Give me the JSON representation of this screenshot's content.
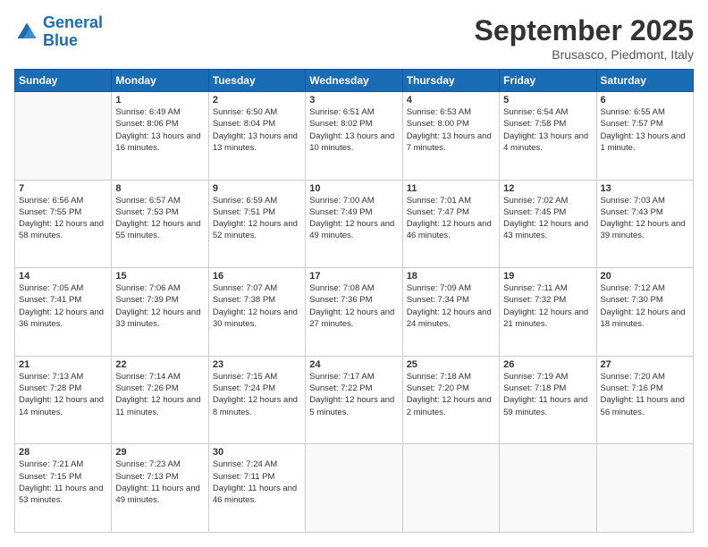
{
  "logo": {
    "line1": "General",
    "line2": "Blue"
  },
  "header": {
    "month": "September 2025",
    "location": "Brusasco, Piedmont, Italy"
  },
  "weekdays": [
    "Sunday",
    "Monday",
    "Tuesday",
    "Wednesday",
    "Thursday",
    "Friday",
    "Saturday"
  ],
  "weeks": [
    [
      {
        "day": "",
        "sunrise": "",
        "sunset": "",
        "daylight": ""
      },
      {
        "day": "1",
        "sunrise": "Sunrise: 6:49 AM",
        "sunset": "Sunset: 8:06 PM",
        "daylight": "Daylight: 13 hours and 16 minutes."
      },
      {
        "day": "2",
        "sunrise": "Sunrise: 6:50 AM",
        "sunset": "Sunset: 8:04 PM",
        "daylight": "Daylight: 13 hours and 13 minutes."
      },
      {
        "day": "3",
        "sunrise": "Sunrise: 6:51 AM",
        "sunset": "Sunset: 8:02 PM",
        "daylight": "Daylight: 13 hours and 10 minutes."
      },
      {
        "day": "4",
        "sunrise": "Sunrise: 6:53 AM",
        "sunset": "Sunset: 8:00 PM",
        "daylight": "Daylight: 13 hours and 7 minutes."
      },
      {
        "day": "5",
        "sunrise": "Sunrise: 6:54 AM",
        "sunset": "Sunset: 7:58 PM",
        "daylight": "Daylight: 13 hours and 4 minutes."
      },
      {
        "day": "6",
        "sunrise": "Sunrise: 6:55 AM",
        "sunset": "Sunset: 7:57 PM",
        "daylight": "Daylight: 13 hours and 1 minute."
      }
    ],
    [
      {
        "day": "7",
        "sunrise": "Sunrise: 6:56 AM",
        "sunset": "Sunset: 7:55 PM",
        "daylight": "Daylight: 12 hours and 58 minutes."
      },
      {
        "day": "8",
        "sunrise": "Sunrise: 6:57 AM",
        "sunset": "Sunset: 7:53 PM",
        "daylight": "Daylight: 12 hours and 55 minutes."
      },
      {
        "day": "9",
        "sunrise": "Sunrise: 6:59 AM",
        "sunset": "Sunset: 7:51 PM",
        "daylight": "Daylight: 12 hours and 52 minutes."
      },
      {
        "day": "10",
        "sunrise": "Sunrise: 7:00 AM",
        "sunset": "Sunset: 7:49 PM",
        "daylight": "Daylight: 12 hours and 49 minutes."
      },
      {
        "day": "11",
        "sunrise": "Sunrise: 7:01 AM",
        "sunset": "Sunset: 7:47 PM",
        "daylight": "Daylight: 12 hours and 46 minutes."
      },
      {
        "day": "12",
        "sunrise": "Sunrise: 7:02 AM",
        "sunset": "Sunset: 7:45 PM",
        "daylight": "Daylight: 12 hours and 43 minutes."
      },
      {
        "day": "13",
        "sunrise": "Sunrise: 7:03 AM",
        "sunset": "Sunset: 7:43 PM",
        "daylight": "Daylight: 12 hours and 39 minutes."
      }
    ],
    [
      {
        "day": "14",
        "sunrise": "Sunrise: 7:05 AM",
        "sunset": "Sunset: 7:41 PM",
        "daylight": "Daylight: 12 hours and 36 minutes."
      },
      {
        "day": "15",
        "sunrise": "Sunrise: 7:06 AM",
        "sunset": "Sunset: 7:39 PM",
        "daylight": "Daylight: 12 hours and 33 minutes."
      },
      {
        "day": "16",
        "sunrise": "Sunrise: 7:07 AM",
        "sunset": "Sunset: 7:38 PM",
        "daylight": "Daylight: 12 hours and 30 minutes."
      },
      {
        "day": "17",
        "sunrise": "Sunrise: 7:08 AM",
        "sunset": "Sunset: 7:36 PM",
        "daylight": "Daylight: 12 hours and 27 minutes."
      },
      {
        "day": "18",
        "sunrise": "Sunrise: 7:09 AM",
        "sunset": "Sunset: 7:34 PM",
        "daylight": "Daylight: 12 hours and 24 minutes."
      },
      {
        "day": "19",
        "sunrise": "Sunrise: 7:11 AM",
        "sunset": "Sunset: 7:32 PM",
        "daylight": "Daylight: 12 hours and 21 minutes."
      },
      {
        "day": "20",
        "sunrise": "Sunrise: 7:12 AM",
        "sunset": "Sunset: 7:30 PM",
        "daylight": "Daylight: 12 hours and 18 minutes."
      }
    ],
    [
      {
        "day": "21",
        "sunrise": "Sunrise: 7:13 AM",
        "sunset": "Sunset: 7:28 PM",
        "daylight": "Daylight: 12 hours and 14 minutes."
      },
      {
        "day": "22",
        "sunrise": "Sunrise: 7:14 AM",
        "sunset": "Sunset: 7:26 PM",
        "daylight": "Daylight: 12 hours and 11 minutes."
      },
      {
        "day": "23",
        "sunrise": "Sunrise: 7:15 AM",
        "sunset": "Sunset: 7:24 PM",
        "daylight": "Daylight: 12 hours and 8 minutes."
      },
      {
        "day": "24",
        "sunrise": "Sunrise: 7:17 AM",
        "sunset": "Sunset: 7:22 PM",
        "daylight": "Daylight: 12 hours and 5 minutes."
      },
      {
        "day": "25",
        "sunrise": "Sunrise: 7:18 AM",
        "sunset": "Sunset: 7:20 PM",
        "daylight": "Daylight: 12 hours and 2 minutes."
      },
      {
        "day": "26",
        "sunrise": "Sunrise: 7:19 AM",
        "sunset": "Sunset: 7:18 PM",
        "daylight": "Daylight: 11 hours and 59 minutes."
      },
      {
        "day": "27",
        "sunrise": "Sunrise: 7:20 AM",
        "sunset": "Sunset: 7:16 PM",
        "daylight": "Daylight: 11 hours and 56 minutes."
      }
    ],
    [
      {
        "day": "28",
        "sunrise": "Sunrise: 7:21 AM",
        "sunset": "Sunset: 7:15 PM",
        "daylight": "Daylight: 11 hours and 53 minutes."
      },
      {
        "day": "29",
        "sunrise": "Sunrise: 7:23 AM",
        "sunset": "Sunset: 7:13 PM",
        "daylight": "Daylight: 11 hours and 49 minutes."
      },
      {
        "day": "30",
        "sunrise": "Sunrise: 7:24 AM",
        "sunset": "Sunset: 7:11 PM",
        "daylight": "Daylight: 11 hours and 46 minutes."
      },
      {
        "day": "",
        "sunrise": "",
        "sunset": "",
        "daylight": ""
      },
      {
        "day": "",
        "sunrise": "",
        "sunset": "",
        "daylight": ""
      },
      {
        "day": "",
        "sunrise": "",
        "sunset": "",
        "daylight": ""
      },
      {
        "day": "",
        "sunrise": "",
        "sunset": "",
        "daylight": ""
      }
    ]
  ]
}
